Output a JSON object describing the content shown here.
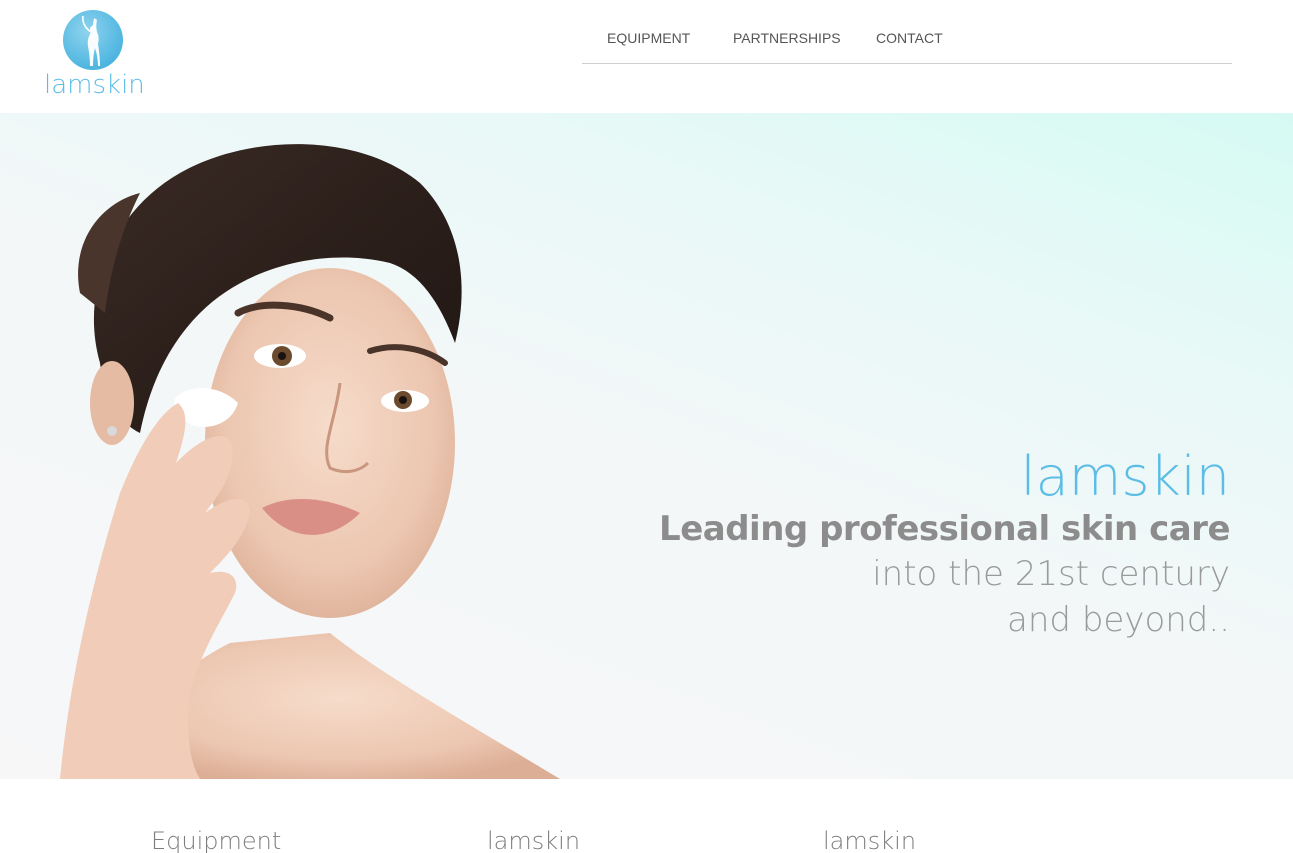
{
  "brand": {
    "logo_text": "lamskin",
    "accent_color": "#5bbde6"
  },
  "nav": {
    "items": [
      {
        "label": "EQUIPMENT"
      },
      {
        "label": "PARTNERSHIPS"
      },
      {
        "label": "CONTACT"
      }
    ]
  },
  "hero": {
    "brand": "lamskin",
    "headline": "Leading professional skin care",
    "line2": "into the 21st century",
    "line3": "and beyond.."
  },
  "sections": [
    {
      "title": "Equipment"
    },
    {
      "title": "lamskin"
    },
    {
      "title": "lamskin"
    }
  ]
}
